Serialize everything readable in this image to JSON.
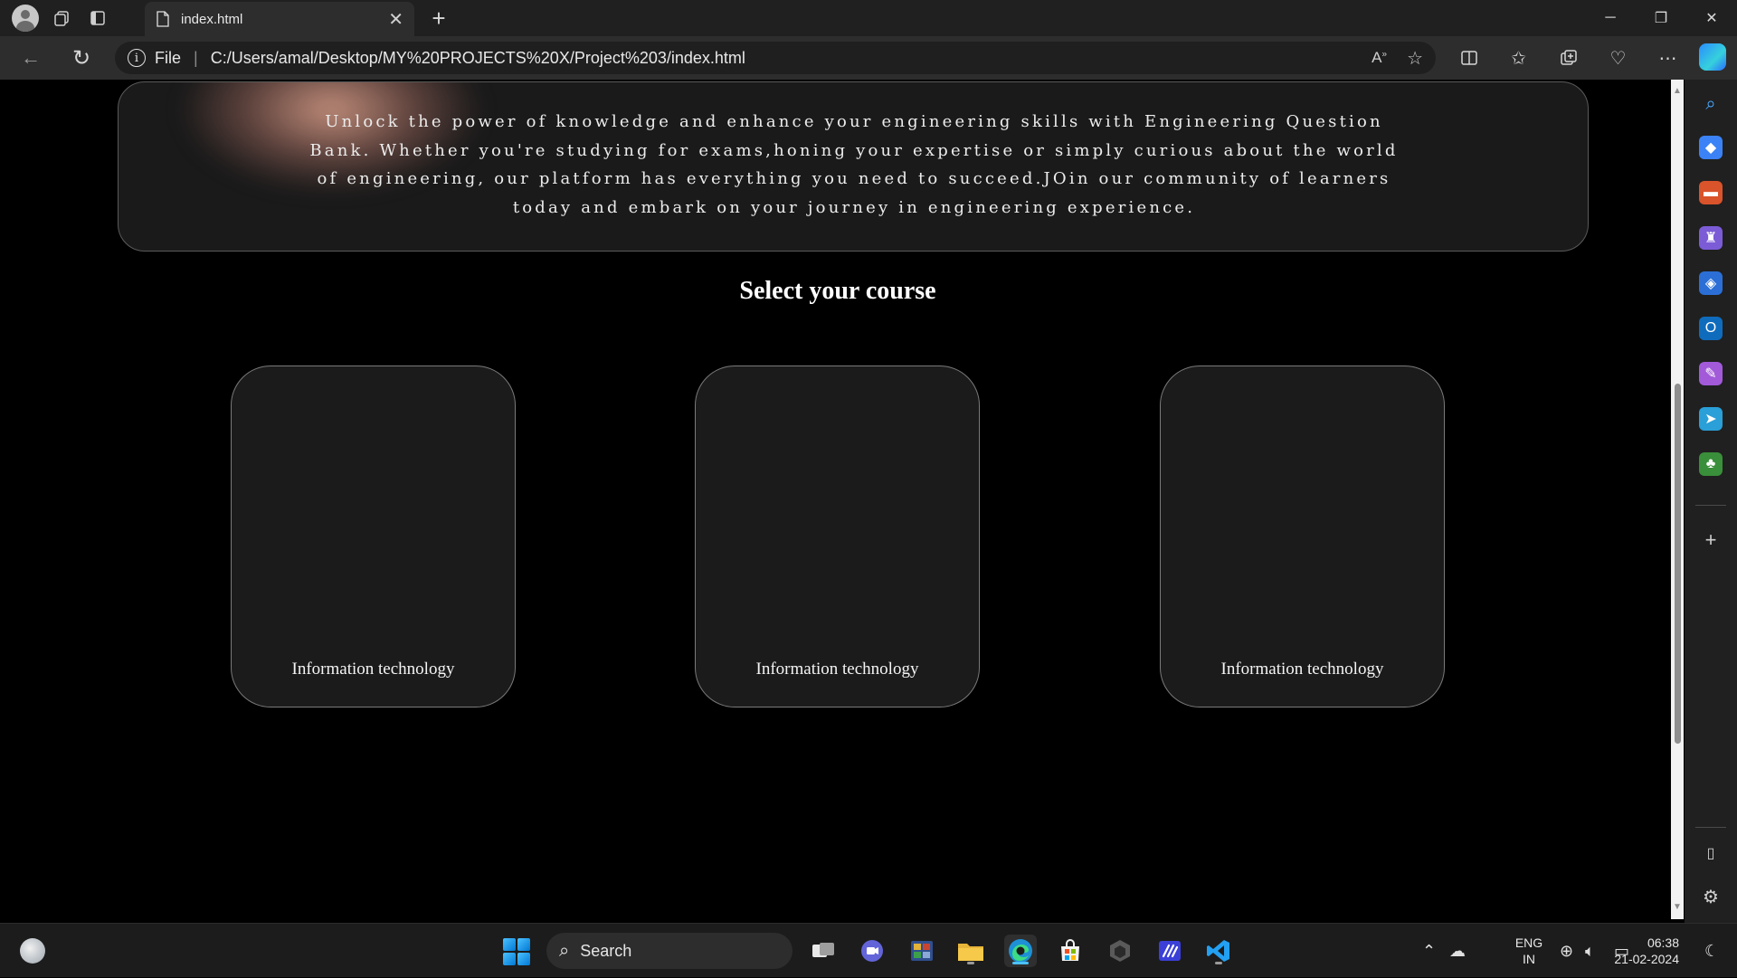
{
  "browser": {
    "tab_title": "index.html",
    "tab_close": "✕",
    "new_tab": "+",
    "address_prefix": "File",
    "url": "C:/Users/amal/Desktop/MY%20PROJECTS%20X/Project%203/index.html"
  },
  "page": {
    "hero_text": "Unlock the power of knowledge and enhance your engineering skills with Engineering Question Bank. Whether you're studying for exams,honing your expertise or simply curious about the world of engineering, our platform has everything you need to succeed.JOin our community of learners today and embark on your journey in engineering experience.",
    "section_title": "Select your course",
    "courses": [
      {
        "label": "Information technology"
      },
      {
        "label": "Information technology"
      },
      {
        "label": "Information technology"
      }
    ]
  },
  "taskbar": {
    "search_label": "Search",
    "language_line1": "ENG",
    "language_line2": "IN",
    "time": "06:38",
    "date": "21-02-2024"
  },
  "colors": {
    "page_background": "#000000",
    "card_background": "#1b1b1b",
    "chrome_dark": "#202020",
    "accent": "#0078d4"
  }
}
